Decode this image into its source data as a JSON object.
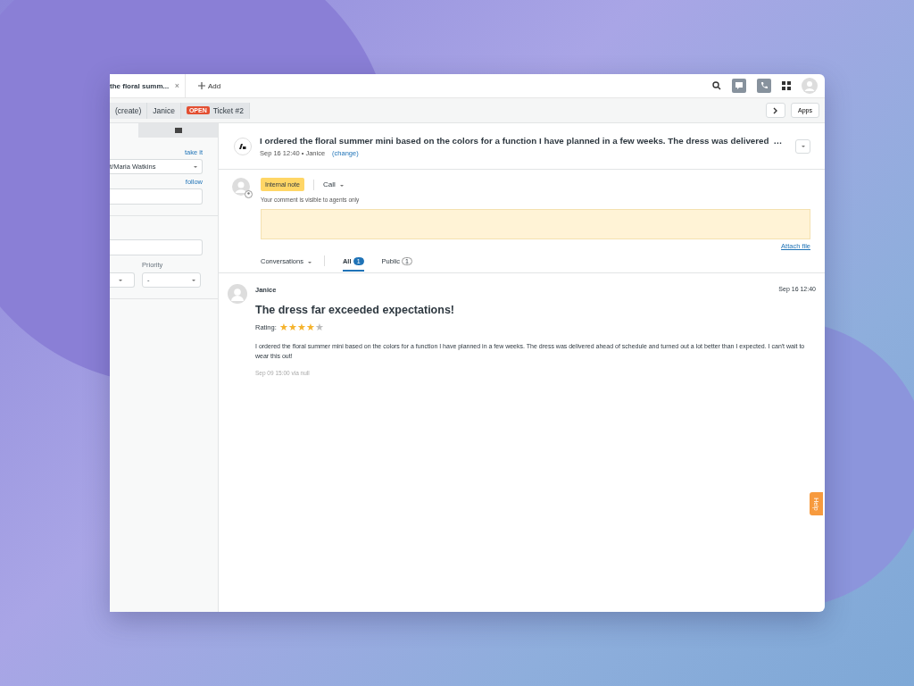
{
  "tabs": [
    {
      "label": "the floral summ...",
      "selected": true,
      "close": "×"
    }
  ],
  "add_tab": {
    "label": "Add"
  },
  "breadcrumbs": [
    {
      "label": "(create)"
    },
    {
      "label": "Janice"
    },
    {
      "label": "Ticket #2",
      "badge": "OPEN"
    }
  ],
  "apps_button": "Apps",
  "sidebar": {
    "assignee_link": "take it",
    "assignee": "t/Maria Watkins",
    "follow_link": "follow",
    "priority_label": "Priority",
    "priority": "-"
  },
  "ticket": {
    "title": "I ordered the floral summer mini based on the colors for a function I have planned in a few weeks. The dress was delivered",
    "ellipsis": "…",
    "meta": "Sep 16 12:40 • Janice",
    "change_link": "(change)"
  },
  "composer": {
    "mode": "Internal note",
    "channel": "Call",
    "hint": "Your comment is visible to agents only",
    "attach": "Attach file"
  },
  "conversations": {
    "filter": "Conversations",
    "tabs": [
      {
        "label": "All",
        "count": "1",
        "selected": true
      },
      {
        "label": "Public",
        "count": "1",
        "selected": false
      }
    ]
  },
  "message": {
    "author": "Janice",
    "time": "Sep 16 12:40",
    "title": "The dress far exceeded expectations!",
    "rating_label": "Rating:",
    "stars": 4,
    "body": "I ordered the floral summer mini based on the colors for a function I have planned in a few weeks. The dress was delivered ahead of schedule and turned out a lot better than I expected. I can't wait to wear this out!",
    "meta": "Sep 09 15:00 via null"
  },
  "help": "Help"
}
